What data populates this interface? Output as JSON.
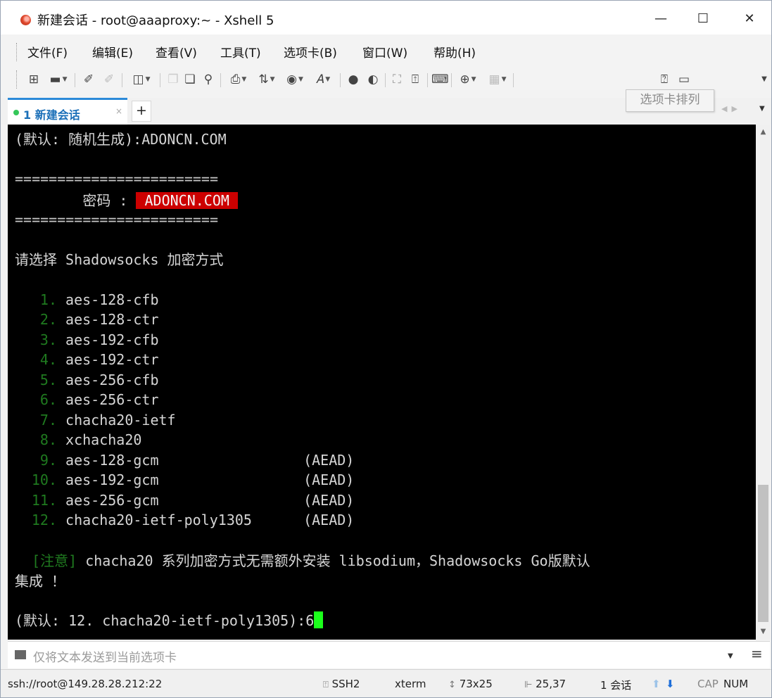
{
  "window": {
    "title": "新建会话 - root@aaaproxy:~ - Xshell 5",
    "controls": {
      "minimize": "—",
      "maximize": "☐",
      "close": "✕"
    }
  },
  "menu": [
    "文件(F)",
    "编辑(E)",
    "查看(V)",
    "工具(T)",
    "选项卡(B)",
    "窗口(W)",
    "帮助(H)"
  ],
  "toolbar_tooltip": "选项卡排列",
  "tab": {
    "label": "1 新建会话",
    "close": "×",
    "new": "+"
  },
  "terminal": {
    "default_label": "(默认: 随机生成):ADONCN.COM",
    "divider": "========================",
    "password_label": "密码 : ",
    "password_value": "ADONCN.COM",
    "prompt": "请选择 Shadowsocks 加密方式",
    "options": [
      {
        "num": "1.",
        "name": "aes-128-cfb",
        "tag": ""
      },
      {
        "num": "2.",
        "name": "aes-128-ctr",
        "tag": ""
      },
      {
        "num": "3.",
        "name": "aes-192-cfb",
        "tag": ""
      },
      {
        "num": "4.",
        "name": "aes-192-ctr",
        "tag": ""
      },
      {
        "num": "5.",
        "name": "aes-256-cfb",
        "tag": ""
      },
      {
        "num": "6.",
        "name": "aes-256-ctr",
        "tag": ""
      },
      {
        "num": "7.",
        "name": "chacha20-ietf",
        "tag": ""
      },
      {
        "num": "8.",
        "name": "xchacha20",
        "tag": ""
      },
      {
        "num": "9.",
        "name": "aes-128-gcm",
        "tag": "(AEAD)"
      },
      {
        "num": "10.",
        "name": "aes-192-gcm",
        "tag": "(AEAD)"
      },
      {
        "num": "11.",
        "name": "aes-256-gcm",
        "tag": "(AEAD)"
      },
      {
        "num": "12.",
        "name": "chacha20-ietf-poly1305",
        "tag": "(AEAD)"
      }
    ],
    "notice_tag": "[注意]",
    "notice_text": " chacha20 系列加密方式无需额外安装 libsodium，Shadowsocks Go版默认",
    "notice_text2": "集成 ！",
    "input_prompt": "(默认: 12. chacha20-ietf-poly1305):6"
  },
  "compose": {
    "placeholder": "仅将文本发送到当前选项卡"
  },
  "status": {
    "address": "ssh://root@149.28.28.212:22",
    "protocol": "SSH2",
    "term_type": "xterm",
    "size": "73x25",
    "cursor_pos": "25,37",
    "sessions": "1 会话",
    "caps": "CAP",
    "num": "NUM"
  },
  "colors": {
    "accent": "#2b8ad8",
    "terminal_bg": "#000000",
    "terminal_fg": "#d6d6d6",
    "highlight_red": "#cc0000",
    "number_green": "#1f7a1f",
    "cursor_green": "#1bff1b"
  }
}
